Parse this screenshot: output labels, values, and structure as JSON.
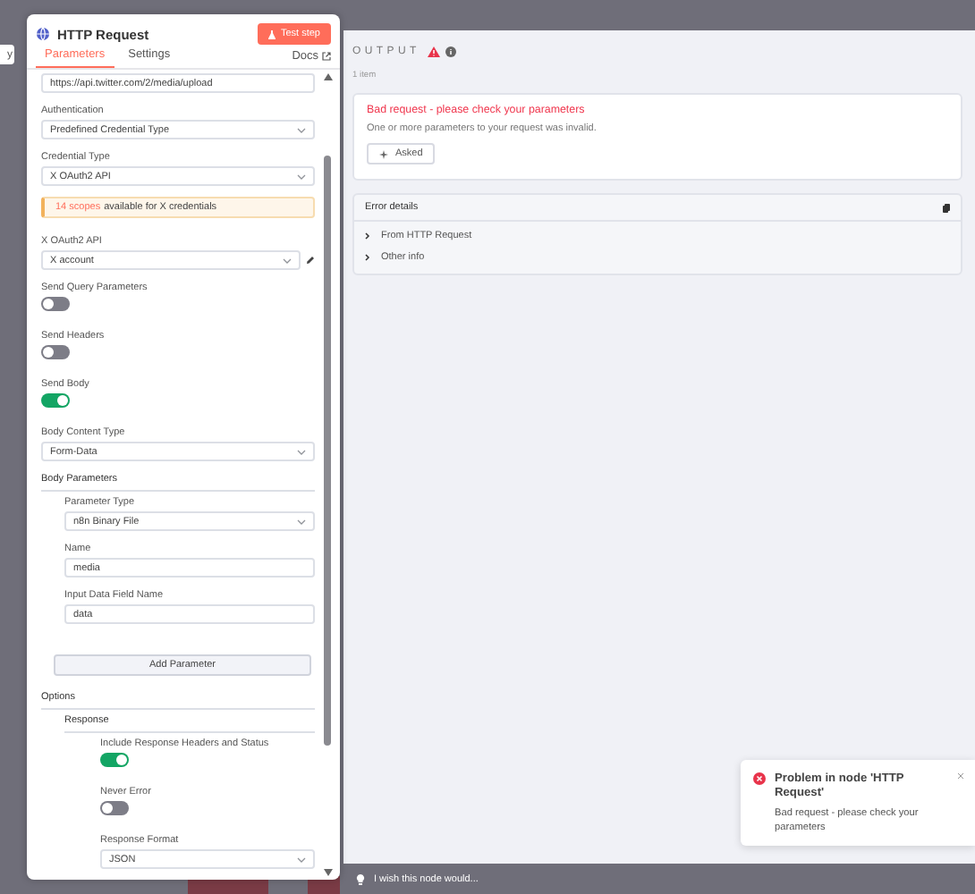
{
  "canvas": {
    "node_label": "y"
  },
  "node_panel": {
    "title": "HTTP Request",
    "test_button": "Test step",
    "tabs": [
      {
        "label": "Parameters",
        "selected": true
      },
      {
        "label": "Settings",
        "selected": false
      }
    ],
    "docs_link": "Docs",
    "parameters": [
      {
        "kind": "input",
        "value": "https://api.twitter.com/2/media/upload"
      },
      {
        "kind": "select",
        "label": "Authentication",
        "value": "Predefined Credential Type"
      },
      {
        "kind": "select",
        "label": "Credential Type",
        "value": "X OAuth2 API"
      },
      {
        "kind": "notice",
        "highlight": "14 scopes",
        "text": "available for X credentials"
      },
      {
        "kind": "credential",
        "label": "X OAuth2 API",
        "value": "X account"
      },
      {
        "kind": "toggle",
        "label": "Send Query Parameters",
        "on": false
      },
      {
        "kind": "toggle",
        "label": "Send Headers",
        "on": false
      },
      {
        "kind": "toggle",
        "label": "Send Body",
        "on": true
      },
      {
        "kind": "select",
        "label": "Body Content Type",
        "value": "Form-Data"
      },
      {
        "kind": "section",
        "label": "Body Parameters",
        "children": [
          {
            "kind": "select",
            "label": "Parameter Type",
            "value": "n8n Binary File"
          },
          {
            "kind": "input",
            "label": "Name",
            "value": "media"
          },
          {
            "kind": "input",
            "label": "Input Data Field Name",
            "value": "data"
          }
        ]
      },
      {
        "kind": "button",
        "label": "Add Parameter"
      },
      {
        "kind": "section",
        "label": "Options",
        "children": [
          {
            "kind": "section",
            "label": "Response",
            "children": [
              {
                "kind": "toggle",
                "label": "Include Response Headers and Status",
                "on": true
              },
              {
                "kind": "toggle",
                "label": "Never Error",
                "on": false
              },
              {
                "kind": "select",
                "label": "Response Format",
                "value": "JSON"
              }
            ]
          }
        ]
      }
    ]
  },
  "output": {
    "title": "OUTPUT",
    "item_count": "1 item",
    "error": {
      "title": "Bad request - please check your parameters",
      "description": "One or more parameters to your request was invalid.",
      "ask_button": "Asked"
    },
    "error_details": {
      "title": "Error details",
      "rows": [
        {
          "label": "From HTTP Request",
          "expanded": false
        },
        {
          "label": "Other info",
          "expanded": false
        }
      ]
    },
    "feedback": "I wish this node would..."
  },
  "toast": {
    "title": "Problem in node 'HTTP Request'",
    "message": "Bad request - please check your parameters"
  }
}
